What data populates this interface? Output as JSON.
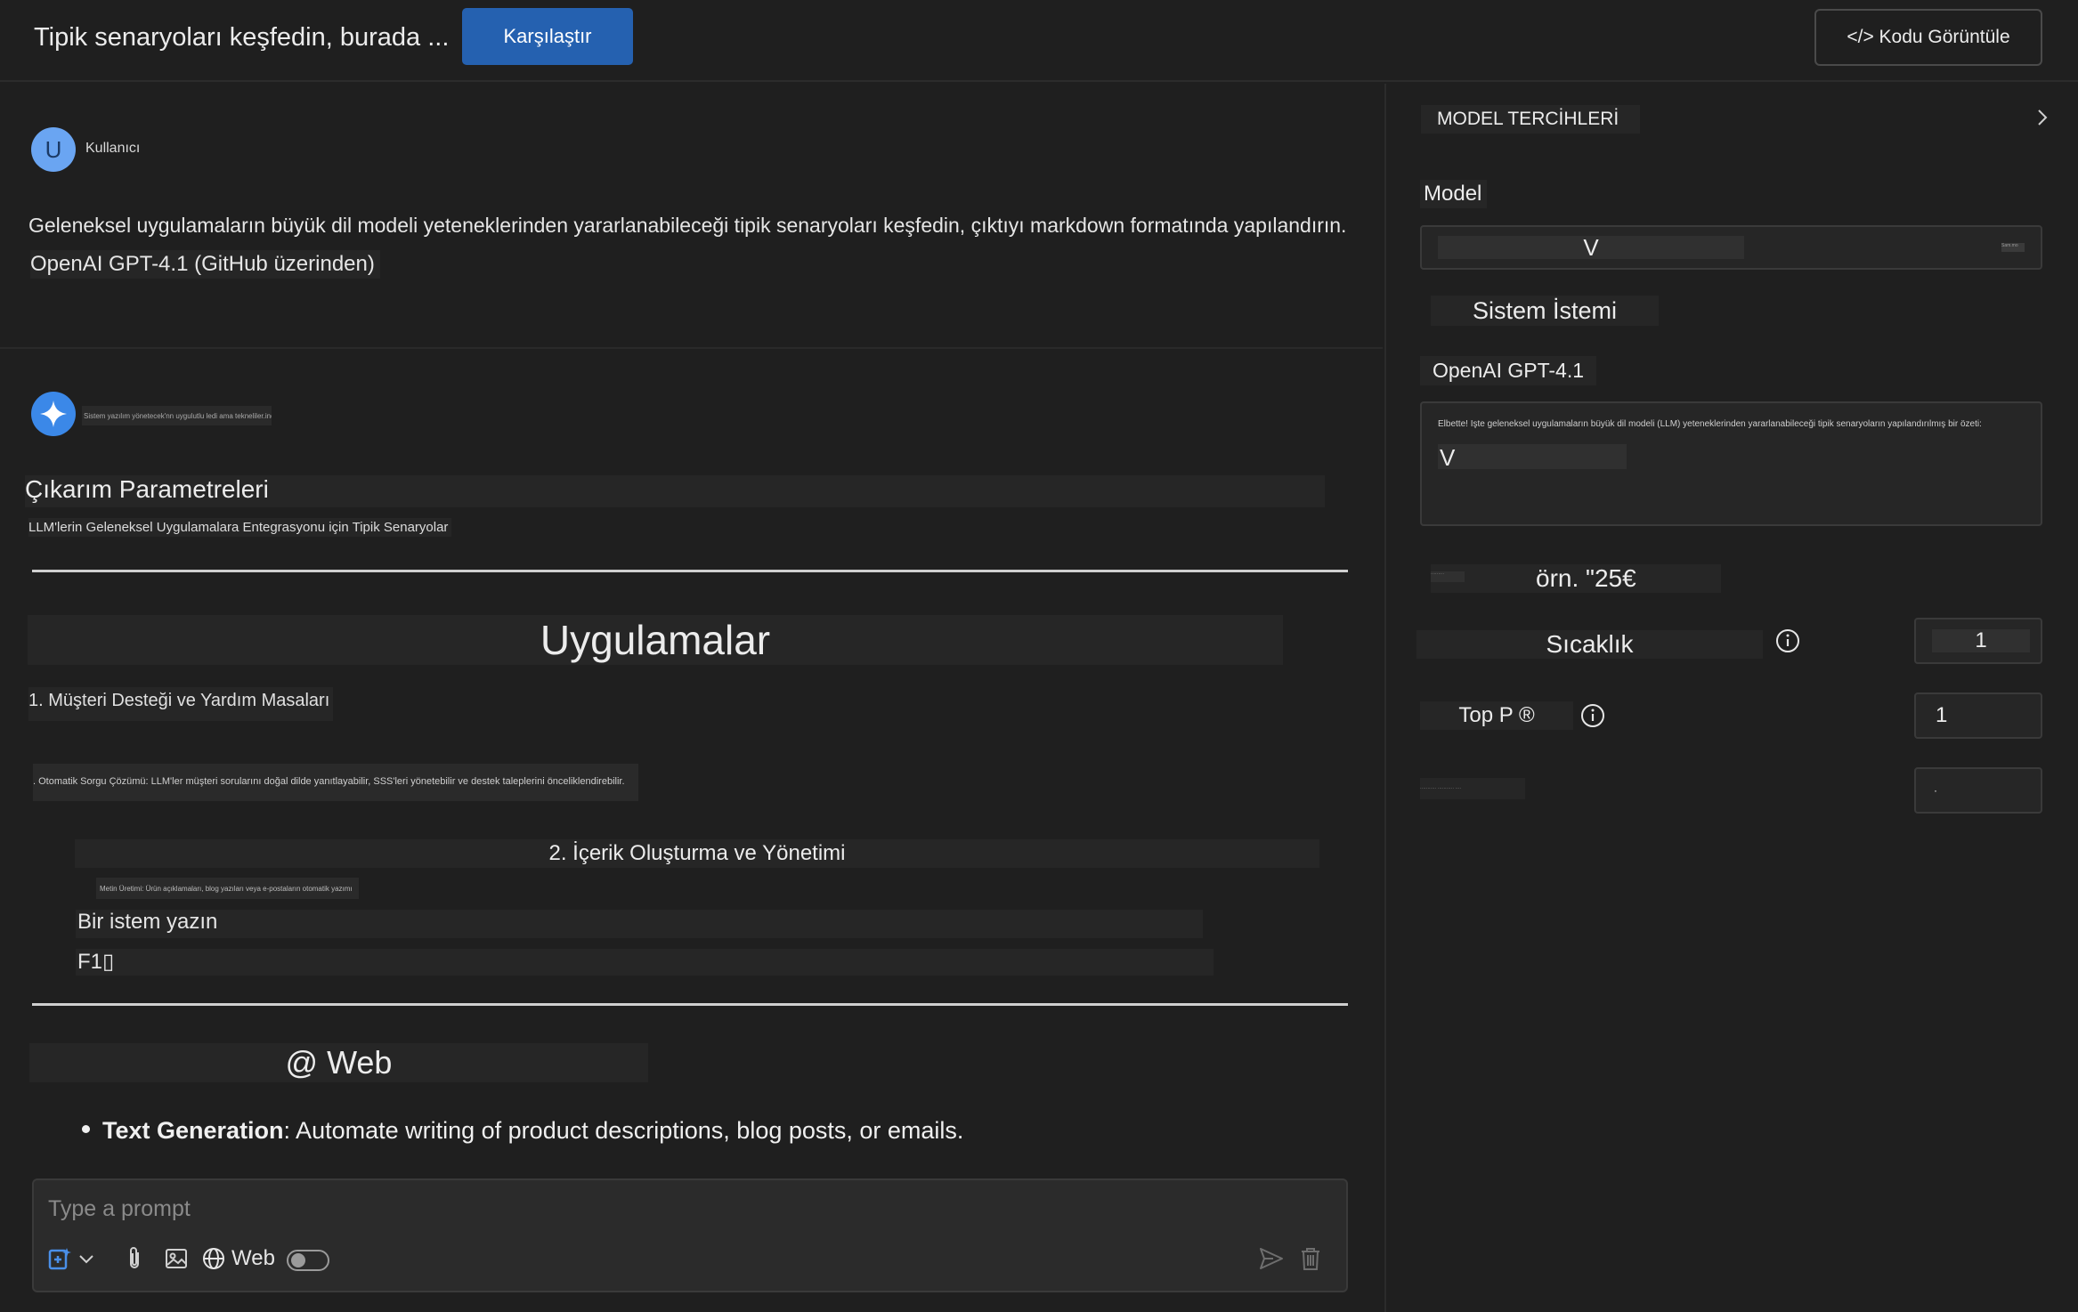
{
  "header": {
    "title": "Tipik senaryoları keşfedin, burada ...",
    "compare_button": "Karşılaştır",
    "view_code_button": "</> Kodu Görüntüle"
  },
  "chat": {
    "user_avatar_letter": "U",
    "user_label": "Kullanıcı",
    "user_message": "Geleneksel uygulamaların büyük dil modeli yeteneklerinden yararlanabileceği tipik senaryoları keşfedin, çıktıyı markdown formatında yapılandırın.",
    "model_line": "OpenAI GPT-4.1 (GitHub üzerinden)",
    "assistant_tiny_text": "Sistem yazılım yönetecek'nn uygulutlu ledi ama tekneliler.ind·nen",
    "inference_heading": "Çıkarım Parametreleri",
    "integration_subtitle": "LLM'lerin Geleneksel Uygulamalara Entegrasyonu için Tipik Senaryolar",
    "applications_heading": "Uygulamalar",
    "item1_title": "1. Müşteri Desteği ve Yardım Masaları",
    "item1_desc": ". Otomatik Sorgu Çözümü: LLM'ler müşteri sorularını doğal dilde yanıtlayabilir, SSS'leri yönetebilir ve destek taleplerini önceliklendirebilir.",
    "item2_title": "2. İçerik Oluşturma ve Yönetimi",
    "item2_desc": "Metin Üretimi: Ürün açıklamaları, blog yazıları veya e-postaların otomatik yazımı",
    "prompt_line": "Bir istem yazın",
    "f1_line": "F1▯",
    "web_heading": "@ Web",
    "bullet_bold": "Text Generation",
    "bullet_rest": ": Automate writing of product descriptions, blog posts, or emails."
  },
  "composer": {
    "placeholder": "Type a prompt",
    "web_label": "Web",
    "web_toggle_on": false
  },
  "preferences": {
    "title": "MODEL TERCİHLERİ",
    "model_label": "Model",
    "model_value": "V",
    "model_mini_text": "Sam.mo",
    "system_prompt_label": "Sistem İstemi",
    "model_name": "OpenAI GPT-4.1",
    "system_prompt_text": "Elbette! İşte geleneksel uygulamaların büyük dil modeli (LLM) yeteneklerinden yararlanabileceği tipik senaryoların yapılandırılmış bir özeti:",
    "system_prompt_v": "V",
    "example_mini_text": "·········",
    "example_text": "örn. \"25€",
    "temperature_label": "Sıcaklık",
    "temperature_value": "1",
    "top_p_label": "Top P ®",
    "top_p_value": "1",
    "max_tokens_label": "··········· ··········· ····",
    "max_tokens_value": "·"
  },
  "colors": {
    "background": "#1f1f1f",
    "accent_button": "#2561b0",
    "user_avatar": "#6aa5f2",
    "assistant_avatar": "#3b88e8"
  }
}
